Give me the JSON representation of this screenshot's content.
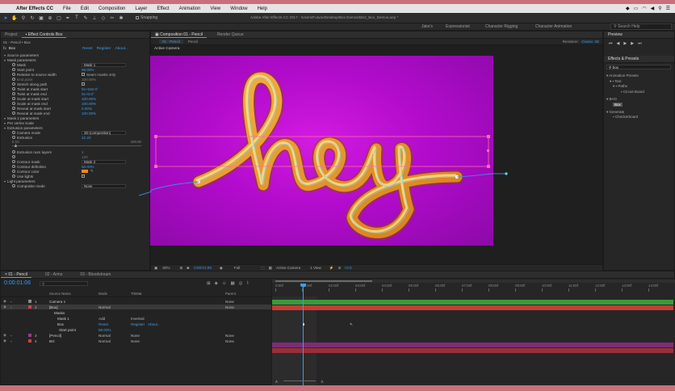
{
  "menubar": {
    "app": "After Effects CC",
    "items": [
      "File",
      "Edit",
      "Composition",
      "Layer",
      "Effect",
      "Animation",
      "View",
      "Window",
      "Help"
    ]
  },
  "toolbar": {
    "snapping": "Snapping",
    "title": "Adobe After Effects CC 2017 - /Users/Future/Desktop/Box Demos/BX2_Box_Demos.aep *",
    "workspaces": [
      "Jake's",
      "Expressionist",
      "Character Rigging",
      "Character Animation"
    ],
    "search": "Search Help"
  },
  "left": {
    "tab_project": "Project",
    "tab_effect": "Effect Controls Box",
    "breadcrumb": "01 - Pencil • Box",
    "effect_name": "Box",
    "reset": "Reset",
    "register": "Register",
    "about": "About...",
    "params": [
      {
        "label": "Source parameters",
        "type": "group"
      },
      {
        "label": "Mask parameters",
        "type": "group"
      },
      {
        "label": "Mask",
        "value": "Mask 1",
        "type": "drop"
      },
      {
        "label": "Start point",
        "value": "58.00%",
        "type": "val"
      },
      {
        "label": "Relative to source width",
        "value": "Seam masks only",
        "type": "check"
      },
      {
        "label": "End point",
        "value": "100.00%",
        "type": "dim"
      },
      {
        "label": "Stretch along path",
        "value": "",
        "type": "check"
      },
      {
        "label": "Twist at mask start",
        "value": "0x+240.0°",
        "type": "val"
      },
      {
        "label": "Twist at mask end",
        "value": "0x+0.0°",
        "type": "val"
      },
      {
        "label": "Scale at mask start",
        "value": "100.00%",
        "type": "val"
      },
      {
        "label": "Scale at mask end",
        "value": "100.00%",
        "type": "val"
      },
      {
        "label": "Reveal at mask start",
        "value": "0.00%",
        "type": "val"
      },
      {
        "label": "Reveal at mask end",
        "value": "100.00%",
        "type": "val"
      },
      {
        "label": "Mask 2 parameters",
        "type": "group"
      },
      {
        "label": "Per vertex scale",
        "type": "group"
      },
      {
        "label": "Extrusion parameters",
        "type": "group"
      },
      {
        "label": "Camera mode",
        "value": "3D (composition)",
        "type": "drop"
      },
      {
        "label": "Extrusion",
        "value": "42.20",
        "type": "val"
      }
    ],
    "slider_min": "0.10",
    "slider_max": "100.00",
    "params2": [
      {
        "label": "Extrusion num layers",
        "value": "1",
        "type": "val"
      },
      {
        "label": "",
        "value": "120",
        "type": "dim"
      },
      {
        "label": "Contour mask",
        "value": "Mask 2",
        "type": "drop"
      },
      {
        "label": "Contour definition",
        "value": "50.00%",
        "type": "val"
      },
      {
        "label": "Contour color",
        "value": "",
        "type": "swatch"
      },
      {
        "label": "Use lights",
        "value": "",
        "type": "check"
      },
      {
        "label": "Light parameters",
        "type": "group"
      },
      {
        "label": "Composite mode",
        "value": "None",
        "type": "drop"
      }
    ]
  },
  "comp": {
    "tab": "Composition 01 - Pencil",
    "tab2": "Render Queue",
    "sub_tab": "01 - Pencil",
    "sub_tab2": "Pencil",
    "renderer_label": "Renderer:",
    "renderer": "Classic 3D",
    "active_camera": "Active Camera",
    "word": "hey",
    "footer": {
      "zoom": "50%",
      "timecode": "0:00:01:06",
      "res": "Full",
      "camera": "Active Camera",
      "view": "1 View",
      "exposure": "+0.0"
    }
  },
  "right": {
    "preview_tab": "Preview",
    "effects_tab": "Effects & Presets",
    "search": "box",
    "tree": [
      "Animation Presets",
      "Text",
      "Paths",
      "Circuit Board",
      "BAO",
      "Box",
      "Generate",
      "Checkerboard"
    ]
  },
  "timeline": {
    "tabs": [
      "01 - Pencil",
      "02 - Arms",
      "03 - Bloodstream"
    ],
    "timecode": "0:00:01:06",
    "columns": {
      "name": "Source Name",
      "mode": "Mode",
      "trk": "TrkMat",
      "parent": "Parent"
    },
    "layers": [
      {
        "num": "1",
        "name": "Camera 1",
        "mode": "",
        "trk": "",
        "parent": "None",
        "color": "#8a8a8a"
      },
      {
        "num": "2",
        "name": "[Box]",
        "mode": "Normal",
        "trk": "",
        "parent": "None",
        "color": "#c94444"
      },
      {
        "num": "",
        "name": "Masks",
        "mode": "",
        "trk": "",
        "parent": "",
        "color": ""
      },
      {
        "num": "",
        "name": "Mask 1",
        "mode": "Add",
        "trk": "Inverted",
        "parent": "",
        "color": ""
      },
      {
        "num": "",
        "name": "Box",
        "mode": "Reset",
        "trk": "Register",
        "parent": "About...",
        "color": ""
      },
      {
        "num": "",
        "name": "Start point",
        "mode": "58.00%",
        "trk": "",
        "parent": "",
        "color": ""
      },
      {
        "num": "3",
        "name": "[Pencil]",
        "mode": "Normal",
        "trk": "None",
        "parent": "None",
        "color": "#9a3a8a"
      },
      {
        "num": "4",
        "name": "BG",
        "mode": "Normal",
        "trk": "None",
        "parent": "None",
        "color": "#c94444"
      }
    ],
    "ruler": [
      "0:00f",
      "01:00f",
      "02:00f",
      "03:00f",
      "04:00f",
      "05:00f",
      "06:00f",
      "07:00f",
      "08:00f",
      "09:00f",
      "10:00f",
      "11:00f",
      "12:00f",
      "13:00f",
      "14:00f"
    ]
  }
}
